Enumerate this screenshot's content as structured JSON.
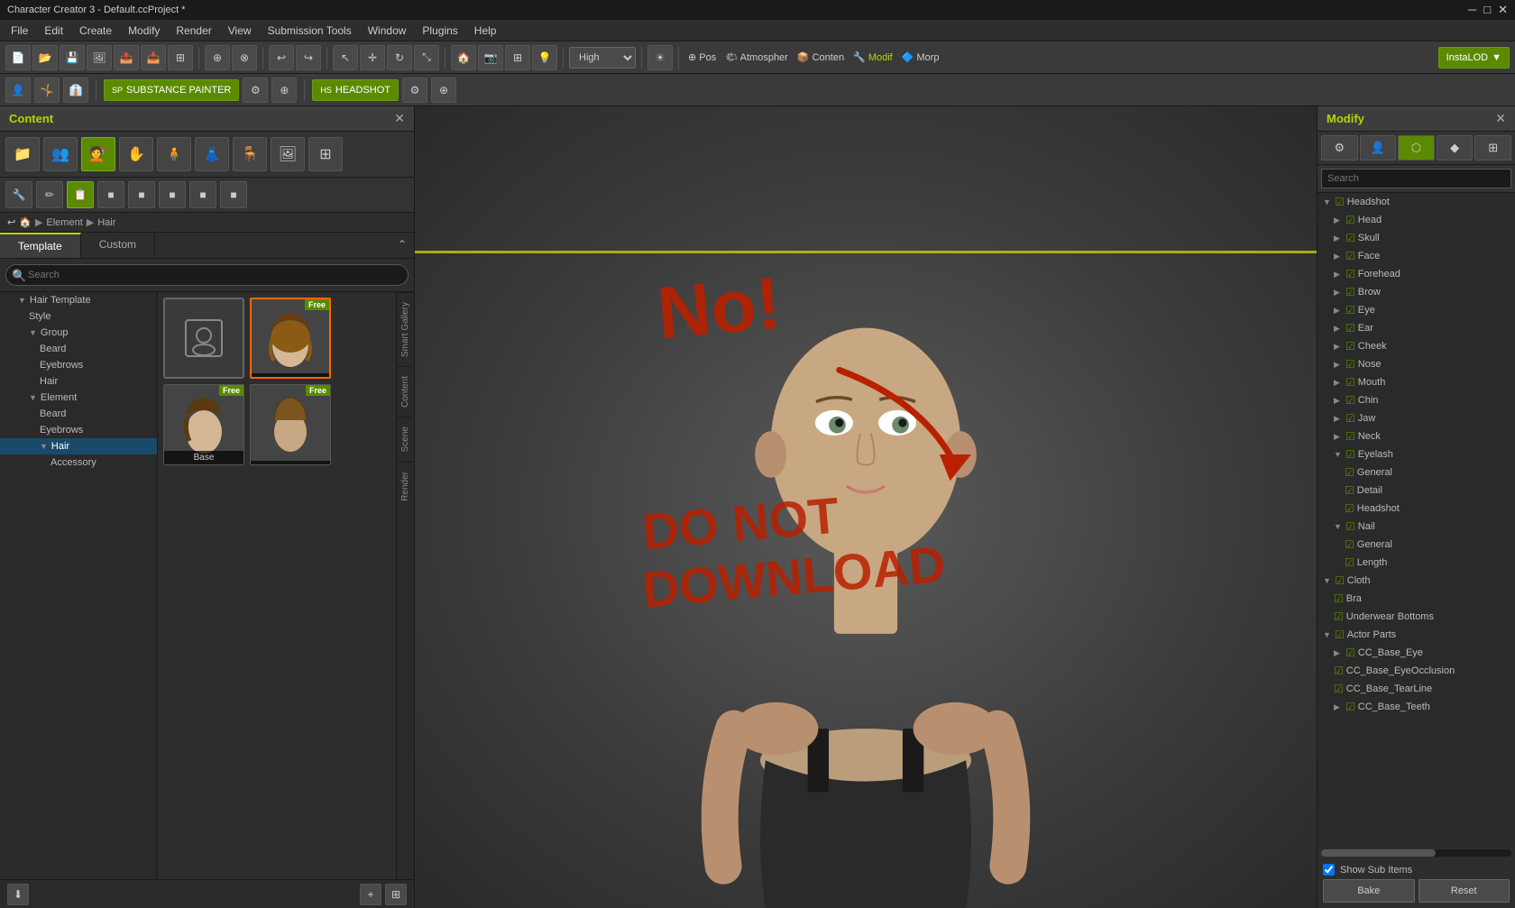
{
  "titlebar": {
    "title": "Character Creator 3 - Default.ccProject *",
    "controls": [
      "─",
      "□",
      "✕"
    ]
  },
  "menubar": {
    "items": [
      "File",
      "Edit",
      "Create",
      "Modify",
      "Render",
      "View",
      "Submission Tools",
      "Window",
      "Plugins",
      "Help"
    ]
  },
  "toolbar1": {
    "quality": "High",
    "modes": [
      "Pos",
      "Atmospher",
      "Conten",
      "Modif",
      "Morp"
    ],
    "instaLOD": "InstaLOD"
  },
  "toolbar2": {
    "substance_painter": "SUBSTANCE PAINTER",
    "headshot": "HEADSHOT"
  },
  "left_panel": {
    "title": "Content",
    "tabs": {
      "template": "Template",
      "custom": "Custom"
    },
    "search_placeholder": "Search",
    "breadcrumb": [
      "Element",
      "Hair"
    ],
    "tree": [
      {
        "label": "Hair Template",
        "level": 0,
        "expanded": true
      },
      {
        "label": "Style",
        "level": 1
      },
      {
        "label": "Group",
        "level": 1,
        "expanded": true
      },
      {
        "label": "Beard",
        "level": 2
      },
      {
        "label": "Eyebrows",
        "level": 2
      },
      {
        "label": "Hair",
        "level": 2
      },
      {
        "label": "Element",
        "level": 1,
        "expanded": true
      },
      {
        "label": "Beard",
        "level": 2
      },
      {
        "label": "Eyebrows",
        "level": 2
      },
      {
        "label": "Hair",
        "level": 2,
        "selected": true
      },
      {
        "label": "Accessory",
        "level": 3
      }
    ],
    "grid_items": [
      {
        "label": "",
        "free": false,
        "type": "folder"
      },
      {
        "label": "",
        "free": true,
        "type": "hair1"
      },
      {
        "label": "Base",
        "free": true,
        "type": "hair2"
      },
      {
        "label": "",
        "free": true,
        "type": "hair3"
      }
    ],
    "side_tabs": [
      "Smart Gallery",
      "Content",
      "Scene",
      "Render"
    ]
  },
  "viewport": {
    "yellow_line": true,
    "annotation": "NO! -> DO NOT DOWNLOAD"
  },
  "right_panel": {
    "title": "Modify",
    "search_placeholder": "Search",
    "icon_tabs": [
      "person",
      "person-edit",
      "shape",
      "morph",
      "checkerboard"
    ],
    "tree": [
      {
        "label": "Headshot",
        "level": 0,
        "expanded": true,
        "checked": true
      },
      {
        "label": "Head",
        "level": 1,
        "checked": true
      },
      {
        "label": "Skull",
        "level": 1,
        "checked": true
      },
      {
        "label": "Face",
        "level": 1,
        "checked": true
      },
      {
        "label": "Forehead",
        "level": 1,
        "checked": true
      },
      {
        "label": "Brow",
        "level": 1,
        "checked": true
      },
      {
        "label": "Eye",
        "level": 1,
        "checked": true
      },
      {
        "label": "Ear",
        "level": 1,
        "checked": true
      },
      {
        "label": "Cheek",
        "level": 1,
        "checked": true
      },
      {
        "label": "Nose",
        "level": 1,
        "checked": true
      },
      {
        "label": "Mouth",
        "level": 1,
        "checked": true
      },
      {
        "label": "Chin",
        "level": 1,
        "checked": true
      },
      {
        "label": "Jaw",
        "level": 1,
        "checked": true
      },
      {
        "label": "Neck",
        "level": 1,
        "checked": true
      },
      {
        "label": "Eyelash",
        "level": 1,
        "expanded": true,
        "checked": true
      },
      {
        "label": "General",
        "level": 2,
        "checked": true
      },
      {
        "label": "Detail",
        "level": 2,
        "checked": true
      },
      {
        "label": "Headshot",
        "level": 2,
        "checked": true
      },
      {
        "label": "Nail",
        "level": 1,
        "expanded": true,
        "checked": true
      },
      {
        "label": "General",
        "level": 2,
        "checked": true
      },
      {
        "label": "Length",
        "level": 2,
        "checked": true
      },
      {
        "label": "Cloth",
        "level": 0,
        "expanded": true,
        "checked": true
      },
      {
        "label": "Bra",
        "level": 1,
        "checked": true
      },
      {
        "label": "Underwear Bottoms",
        "level": 1,
        "checked": true
      },
      {
        "label": "Actor Parts",
        "level": 0,
        "expanded": true,
        "checked": true
      },
      {
        "label": "CC_Base_Eye",
        "level": 1,
        "checked": true,
        "has_arrow": true
      },
      {
        "label": "CC_Base_EyeOcclusion",
        "level": 1,
        "checked": true
      },
      {
        "label": "CC_Base_TearLine",
        "level": 1,
        "checked": true
      },
      {
        "label": "CC_Base_Teeth",
        "level": 1,
        "checked": true,
        "has_arrow": true
      }
    ],
    "show_sub_items": "Show Sub Items",
    "buttons": {
      "bake": "Bake",
      "reset": "Reset"
    }
  }
}
